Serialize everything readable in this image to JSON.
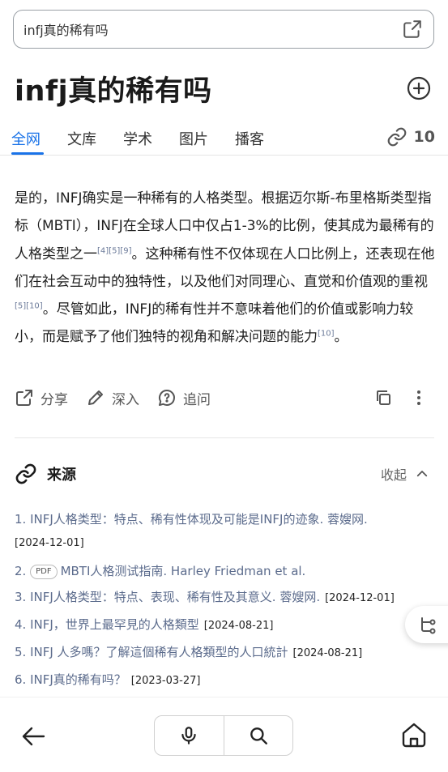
{
  "search": {
    "query": "infj真的稀有吗"
  },
  "header": {
    "title": "infj真的稀有吗"
  },
  "tabs": [
    {
      "label": "全网",
      "active": true
    },
    {
      "label": "文库"
    },
    {
      "label": "学术"
    },
    {
      "label": "图片"
    },
    {
      "label": "播客"
    }
  ],
  "links_count": "10",
  "answer": {
    "p1": "是的，INFJ确实是一种稀有的人格类型。根据迈尔斯-布里格斯类型指标（MBTI），INFJ在全球人口中仅占1-3%的比例，使其成为最稀有的人格类型之一",
    "ref1": "[4][5][9]",
    "p2": "。这种稀有性不仅体现在人口比例上，还表现在他们在社会互动中的独特性，以及他们对同理心、直觉和价值观的重视",
    "ref2": "[5][10]",
    "p3": "。尽管如此，INFJ的稀有性并不意味着他们的价值或影响力较小，而是赋予了他们独特的视角和解决问题的能力",
    "ref3": "[10]",
    "p4": "。"
  },
  "actions": {
    "share": "分享",
    "deepen": "深入",
    "followup": "追问"
  },
  "sources": {
    "label": "来源",
    "collapse": "收起",
    "items": [
      {
        "text": "1. INFJ人格类型：特点、稀有性体现及可能是INFJ的迹象. 蓉嫂网.",
        "date": "[2024-12-01]"
      },
      {
        "badge": "PDF",
        "num": "2.",
        "text": "MBTI人格测试指南. Harley Friedman et al."
      },
      {
        "text": "3. INFJ人格类型：特点、表现、稀有性及其意义. 蓉嫂网.",
        "date": "[2024-12-01]"
      },
      {
        "text": "4. INFJ，世界上最罕見的人格類型",
        "date": "[2024-08-21]"
      },
      {
        "text": "5. INFJ 人多嗎？了解這個稀有人格類型的人口統計",
        "date": "[2024-08-21]"
      },
      {
        "text": "6. INFJ真的稀有吗？",
        "date": "[2023-03-27]"
      }
    ]
  },
  "colors": {
    "accent": "#1a73e8",
    "source_link": "#5b6b8c"
  }
}
